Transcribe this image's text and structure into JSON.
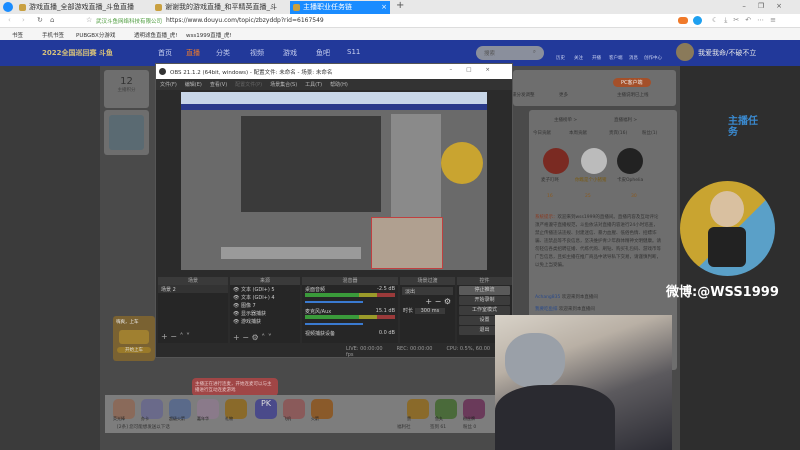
{
  "browser": {
    "tabs": [
      {
        "label": "游戏直播_全部游戏直播_斗鱼直播"
      },
      {
        "label": "谢谢我的游戏直播_和平精英直播_斗"
      },
      {
        "label": "主播职业任务链"
      }
    ],
    "new_tab": "+",
    "url": "https://www.douyu.com/topic/zbzyddp?rid=6167549",
    "site_identity": "武汉斗鱼网络科技有限公司",
    "bookmarks": [
      "书签",
      "手机书签",
      "PUBGBX分游戏",
      "透明滤鱼直播_虎!",
      "wss1999直播_虎!"
    ]
  },
  "site": {
    "logo": "2022全国巡回赛 斗鱼",
    "nav": [
      "首页",
      "直播",
      "分类",
      "视频",
      "游戏",
      "鱼吧",
      "S11"
    ],
    "search_placeholder": "搜索",
    "icons": [
      "历史",
      "关注",
      "开播",
      "客户端",
      "消息",
      "创作中心"
    ],
    "user_banner": "我爱我命/不破不立",
    "follow_count": "12",
    "follow_label": "主播积分",
    "toolbar": [
      "小飞碟分发调整",
      "更多"
    ],
    "pc_button": "PC客户端",
    "pc_sub": "主播说明已上线",
    "rank_tabs": [
      "今日贡献",
      "本周贡献",
      "贵宾(16)",
      "粉丝(1)"
    ],
    "rank_links": [
      "主播榜单 >",
      "直播福利 >"
    ],
    "rank_users": [
      {
        "name": "麦子叮咚",
        "level": "16"
      },
      {
        "name": "你瞧是个小猪猪",
        "level": "25"
      },
      {
        "name": "卡皮Ophelia",
        "level": "30"
      }
    ],
    "notice_title": "系统提示：",
    "notice_text": "欢迎来到wss1999的直播间。直播内容及互动评论须严格遵守直播规范，斗鱼依法对直播内容进行24小时巡查，禁止传播违法违规、封建迷信、暴力血腥、低俗色情、招嫖诈骗、违禁品等不良信息，坚决维护青少年群体精神文明健康。请勿轻信各类招聘征婚、代练代购、刷钻、购买礼包码、游戏币等广告信息，且如主播在推广商品中诱导私下交易，请谨慎判断，以免上当受骗。",
    "chat": [
      {
        "user": "Achang835",
        "text": "欢迎来到本直播间"
      },
      {
        "user": "我要吃鱼排",
        "text": "欢迎来到本直播间"
      }
    ],
    "overlay_weibo": "微博:@WSS1999",
    "mission_badge": "主播任务",
    "promo_title": "嗨爽，上车",
    "promo_button": "开始上车",
    "tooltip": "主播正在进行连麦，开始连麦可以与主播进行互动连麦游戏",
    "gifts": [
      "荧光棒",
      "办卡",
      "超级火箭",
      "嘉年华",
      "PK",
      "飞机",
      "火箭",
      "礼物",
      "赞",
      "鱼丸",
      "粉丝牌"
    ],
    "chat_input": "[2条] 您可能想发送以下话",
    "footer_items": [
      "福利社",
      "签到 61",
      "粉丝 0"
    ]
  },
  "obs": {
    "title": "OBS 21.1.2 (64bit, windows) - 配置文件: 未命名 - 场景: 未命名",
    "menu": [
      "文件(F)",
      "编辑(E)",
      "查看(V)",
      "配置文件(P)",
      "场景集合(S)",
      "工具(T)",
      "帮助(H)"
    ],
    "panels": {
      "scenes": "场景",
      "sources": "来源",
      "mixer": "混音器",
      "transitions": "场景过渡",
      "controls": "控件"
    },
    "scenes": [
      "场景 2"
    ],
    "sources": [
      "文本 (GDI+) 5",
      "文本 (GDI+) 4",
      "图像 7",
      "显示器捕获",
      "游戏捕获"
    ],
    "mixer": [
      {
        "name": "桌面音频",
        "db": "-2.5 dB",
        "level": 0.75
      },
      {
        "name": "麦克风/Aux",
        "db": "15.1 dB",
        "level": 0.55
      },
      {
        "name": "视频捕获设备",
        "db": "0.0 dB",
        "level": 0
      }
    ],
    "transition": "淡出",
    "duration_label": "时长",
    "duration": "300 ms",
    "controls": [
      "停止推流",
      "开始录制",
      "工作室模式",
      "设置",
      "退出"
    ],
    "status": {
      "live": "LIVE: 00:00:00",
      "rec": "REC: 00:00:00",
      "cpu": "CPU: 0.5%, 60.00 fps"
    }
  },
  "colors": {
    "nav": "#22399a",
    "tab_active": "#1a8cff",
    "accent": "#f0732d"
  }
}
